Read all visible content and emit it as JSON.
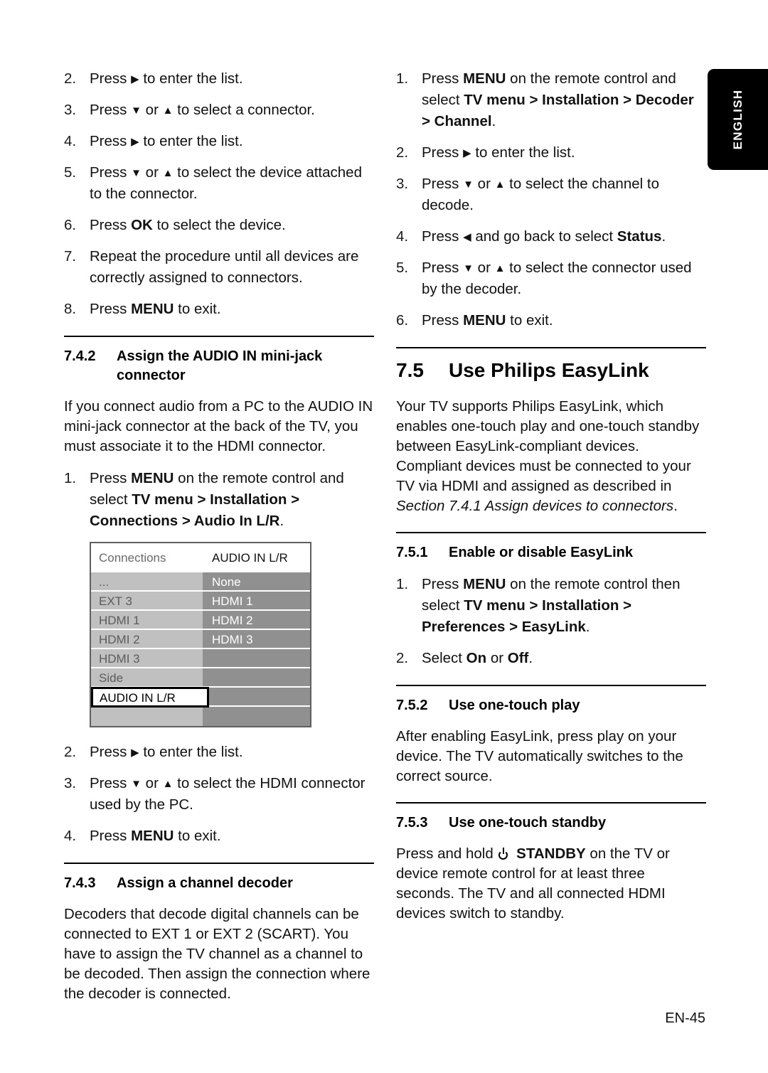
{
  "page": {
    "footer": "EN-45",
    "language_tab": "ENGLISH"
  },
  "left_column": {
    "steps_continued": [
      {
        "num": "2.",
        "text_html": "Press <span class=\"arrow\">&#9654;</span> to enter the list."
      },
      {
        "num": "3.",
        "text_html": "Press <span class=\"arrow\">&#9660;</span> or <span class=\"arrow\">&#9650;</span> to select a connector."
      },
      {
        "num": "4.",
        "text_html": "Press <span class=\"arrow\">&#9654;</span> to enter the list."
      },
      {
        "num": "5.",
        "text_html": "Press <span class=\"arrow\">&#9660;</span> or <span class=\"arrow\">&#9650;</span> to select the device attached to the connector."
      },
      {
        "num": "6.",
        "text_html": "Press <b>OK</b> to select the device."
      },
      {
        "num": "7.",
        "text_html": "Repeat the procedure until all devices are correctly assigned to connectors."
      },
      {
        "num": "8.",
        "text_html": "Press <b>MENU</b> to exit."
      }
    ],
    "section_742": {
      "number": "7.4.2",
      "title": "Assign the AUDIO IN mini-jack connector",
      "paragraph": "If you connect audio from a PC to the AUDIO IN mini-jack connector at the back of the TV, you must associate it to the HDMI connector.",
      "steps_before_menu": [
        {
          "num": "1.",
          "text_html": "Press <b>MENU</b> on the remote control and select <b>TV menu &gt; Installation &gt; Connections &gt; Audio In L/R</b>."
        }
      ],
      "steps_after_menu": [
        {
          "num": "2.",
          "text_html": "Press <span class=\"arrow\">&#9654;</span> to enter the list."
        },
        {
          "num": "3.",
          "text_html": "Press <span class=\"arrow\">&#9660;</span> or <span class=\"arrow\">&#9650;</span> to select the HDMI connector used by the PC."
        },
        {
          "num": "4.",
          "text_html": "Press <b>MENU</b> to exit."
        }
      ]
    },
    "tv_menu": {
      "header_left": "Connections",
      "header_right": "AUDIO IN L/R",
      "left_items": [
        "...",
        "EXT 3",
        "HDMI 1",
        "HDMI 2",
        "HDMI 3",
        "Side",
        "",
        ""
      ],
      "right_items": [
        "None",
        "HDMI 1",
        "HDMI 2",
        "HDMI 3",
        "",
        "",
        "",
        ""
      ],
      "selected_label": "AUDIO IN L/R",
      "selected_row_index": 6,
      "colors": {
        "left_column_bg": "#c0c0c0",
        "right_column_bg": "#909090",
        "header_bg": "#ffffff",
        "border": "#5f5f5f",
        "selection_border": "#000000"
      }
    },
    "section_743": {
      "number": "7.4.3",
      "title": "Assign a channel decoder",
      "paragraph": "Decoders that decode digital channels can be connected to EXT 1 or EXT 2 (SCART). You have to assign the TV channel as a channel to be decoded. Then assign the connection where the decoder is connected."
    }
  },
  "right_column": {
    "decoder_steps": [
      {
        "num": "1.",
        "text_html": "Press <b>MENU</b> on the remote control and select <b>TV menu &gt; Installation &gt; Decoder &gt; Channel</b>."
      },
      {
        "num": "2.",
        "text_html": "Press <span class=\"arrow\">&#9654;</span> to enter the list."
      },
      {
        "num": "3.",
        "text_html": "Press <span class=\"arrow\">&#9660;</span> or <span class=\"arrow\">&#9650;</span> to select the channel to decode."
      },
      {
        "num": "4.",
        "text_html": "Press <span class=\"arrow\">&#9664;</span> and go back to select <b>Status</b>."
      },
      {
        "num": "5.",
        "text_html": "Press <span class=\"arrow\">&#9660;</span> or <span class=\"arrow\">&#9650;</span> to select the connector used by the decoder."
      },
      {
        "num": "6.",
        "text_html": "Press <b>MENU</b> to exit."
      }
    ],
    "section_75": {
      "number": "7.5",
      "title": "Use Philips EasyLink",
      "paragraph_html": "Your TV supports Philips EasyLink, which enables one-touch play and one-touch standby between EasyLink-compliant devices. Compliant devices must be connected to your TV via HDMI and assigned as described in <span class=\"ital\">Section 7.4.1 Assign devices to connectors</span>."
    },
    "section_751": {
      "number": "7.5.1",
      "title": "Enable or disable EasyLink",
      "steps": [
        {
          "num": "1.",
          "text_html": "Press <b>MENU</b> on the remote control then select <b>TV menu &gt; Installation &gt; Preferences &gt; EasyLink</b>."
        },
        {
          "num": "2.",
          "text_html": "Select <b>On</b> or <b>Off</b>."
        }
      ]
    },
    "section_752": {
      "number": "7.5.2",
      "title": "Use one-touch play",
      "paragraph": "After enabling EasyLink, press play on your device. The TV automatically switches to the correct source."
    },
    "section_753": {
      "number": "7.5.3",
      "title": "Use one-touch standby",
      "paragraph_html": "Press and hold <span class=\"power-glyph\" data-name=\"standby-power-icon\" data-interactable=\"false\"></span> <b>STANDBY</b> on the TV or device remote control for at least three seconds. The TV and all connected HDMI devices switch to standby."
    }
  }
}
